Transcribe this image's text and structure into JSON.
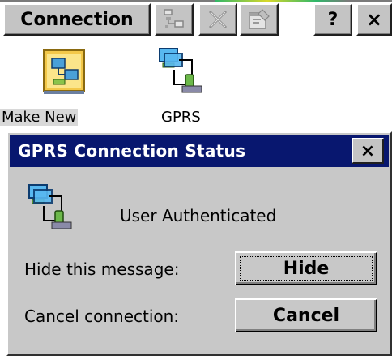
{
  "toolbar": {
    "menu_label": "Connection",
    "icons": [
      "network-view-icon",
      "delete-icon",
      "properties-icon"
    ],
    "help_label": "?",
    "close_label": "×"
  },
  "desktop": {
    "items": [
      {
        "label": "Make New",
        "icon": "make-new-connection-icon",
        "selected": true
      },
      {
        "label": "GPRS",
        "icon": "gprs-connection-icon",
        "selected": false
      }
    ]
  },
  "dialog": {
    "title": "GPRS Connection Status",
    "close_label": "×",
    "status": "User Authenticated",
    "hide_label": "Hide this message:",
    "hide_button": "Hide",
    "cancel_label": "Cancel connection:",
    "cancel_button": "Cancel"
  },
  "colors": {
    "titlebar": "#08176f",
    "face": "#c8c8c8",
    "background": "#ffffff"
  }
}
